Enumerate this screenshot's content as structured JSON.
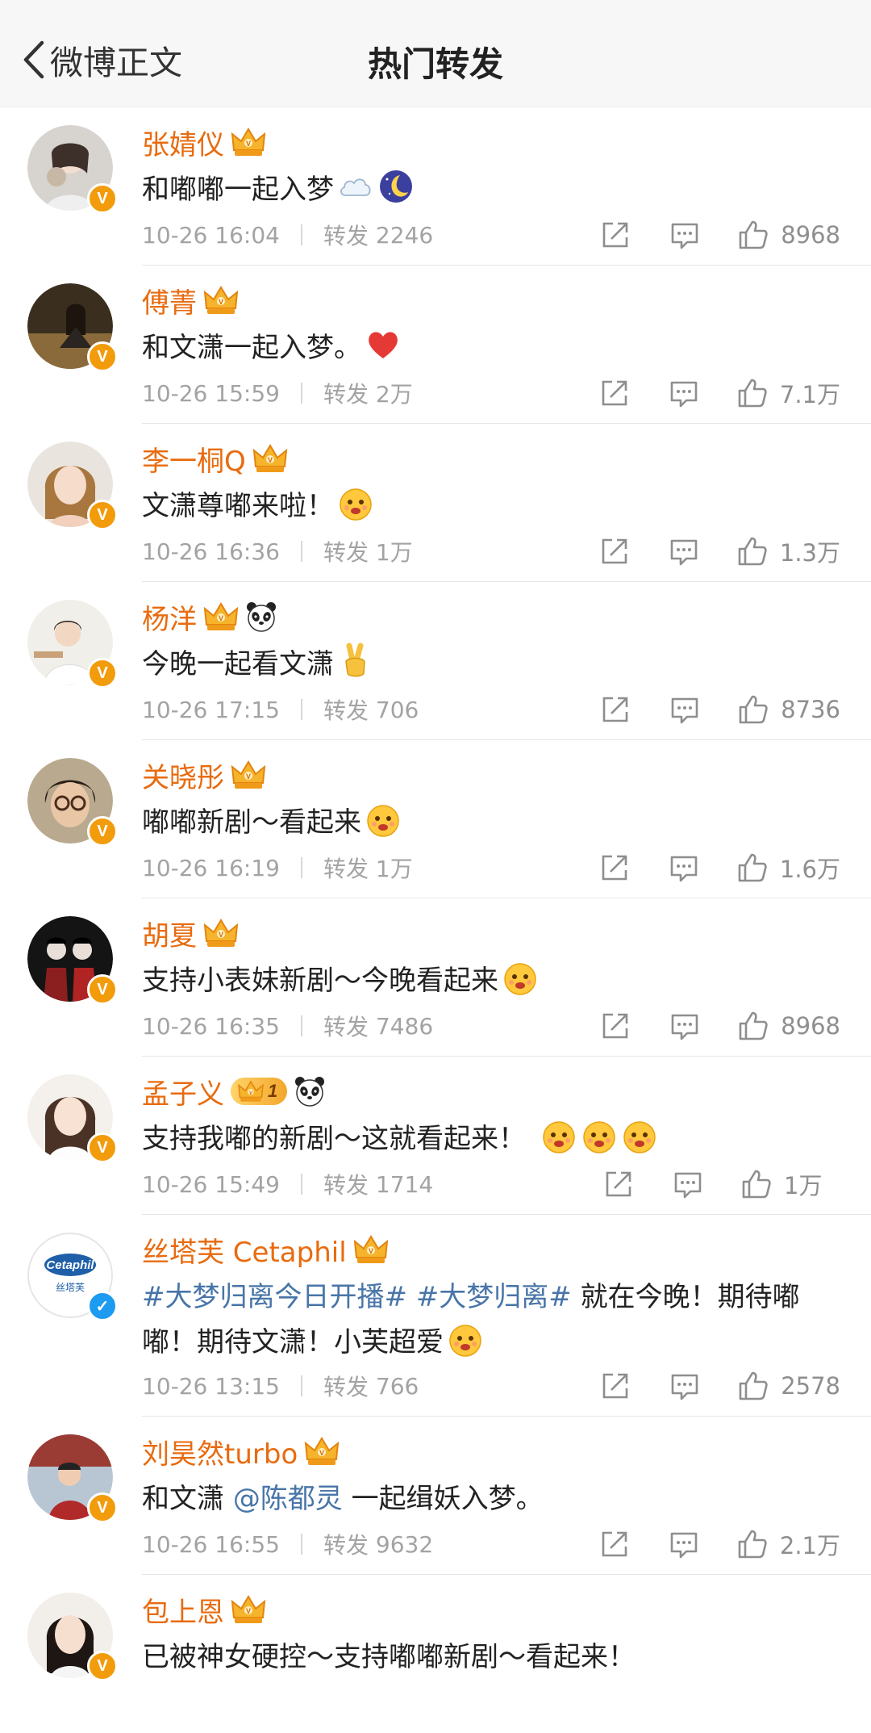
{
  "header": {
    "back_label": "微博正文",
    "title": "热门转发"
  },
  "colors": {
    "name": "#e86b0f",
    "link": "#4875a8",
    "meta": "#a3a3a3",
    "badge_gold": "#f29b0b",
    "badge_blue": "#1d9bf0"
  },
  "reposts": [
    {
      "name": "张婧仪",
      "text": "和嘟嘟一起入梦",
      "emoji": [
        "cloud-emoji",
        "moon-emoji"
      ],
      "time": "10-26 16:04",
      "repost_label": "转发",
      "repost_count": "2246",
      "likes": "8968",
      "badge": "gold"
    },
    {
      "name": "傅菁",
      "text": "和文潇一起入梦。",
      "emoji": [
        "heart-emoji"
      ],
      "time": "10-26 15:59",
      "repost_label": "转发",
      "repost_count": "2万",
      "likes": "7.1万",
      "badge": "gold"
    },
    {
      "name": "李一桐Q",
      "text": "文潇尊嘟来啦！",
      "emoji": [
        "flower-face-emoji"
      ],
      "time": "10-26 16:36",
      "repost_label": "转发",
      "repost_count": "1万",
      "likes": "1.3万",
      "badge": "gold"
    },
    {
      "name": "杨洋",
      "text": "今晚一起看文潇",
      "emoji": [
        "victory-hand-emoji"
      ],
      "time": "10-26 17:15",
      "repost_label": "转发",
      "repost_count": "706",
      "likes": "8736",
      "badge": "gold"
    },
    {
      "name": "关晓彤",
      "text": "嘟嘟新剧～看起来",
      "emoji": [
        "excited-face-emoji"
      ],
      "time": "10-26 16:19",
      "repost_label": "转发",
      "repost_count": "1万",
      "likes": "1.6万",
      "badge": "gold"
    },
    {
      "name": "胡夏",
      "text": "支持小表妹新剧～今晚看起来",
      "emoji": [
        "cheer-emoji"
      ],
      "time": "10-26 16:35",
      "repost_label": "转发",
      "repost_count": "7486",
      "likes": "8968",
      "badge": "gold"
    },
    {
      "name": "孟子义",
      "text": "支持我嘟的新剧～这就看起来！",
      "emoji": [
        "love-face-emoji",
        "love-face-emoji",
        "love-face-emoji"
      ],
      "time": "10-26 15:49",
      "repost_label": "转发",
      "repost_count": "1714",
      "likes": "1万",
      "badge": "gold",
      "vip_level": "1"
    },
    {
      "name": "丝塔芙 Cetaphil",
      "topic1": "#大梦归离今日开播#",
      "topic2": "#大梦归离#",
      "text": " 就在今晚！期待嘟嘟！期待文潇！小芙超爱",
      "emoji": [
        "adore-face-emoji"
      ],
      "time": "10-26 13:15",
      "repost_label": "转发",
      "repost_count": "766",
      "likes": "2578",
      "badge": "blue",
      "logo_text": "Cetaphil",
      "logo_sub": "丝塔芙"
    },
    {
      "name": "刘昊然turbo",
      "text_before": "和文潇 ",
      "mention": "@陈都灵",
      "text_after": " 一起缉妖入梦。",
      "time": "10-26 16:55",
      "repost_label": "转发",
      "repost_count": "9632",
      "likes": "2.1万",
      "badge": "gold"
    },
    {
      "name": "包上恩",
      "text": "已被神女硬控～支持嘟嘟新剧～看起来！",
      "badge": "gold"
    }
  ]
}
